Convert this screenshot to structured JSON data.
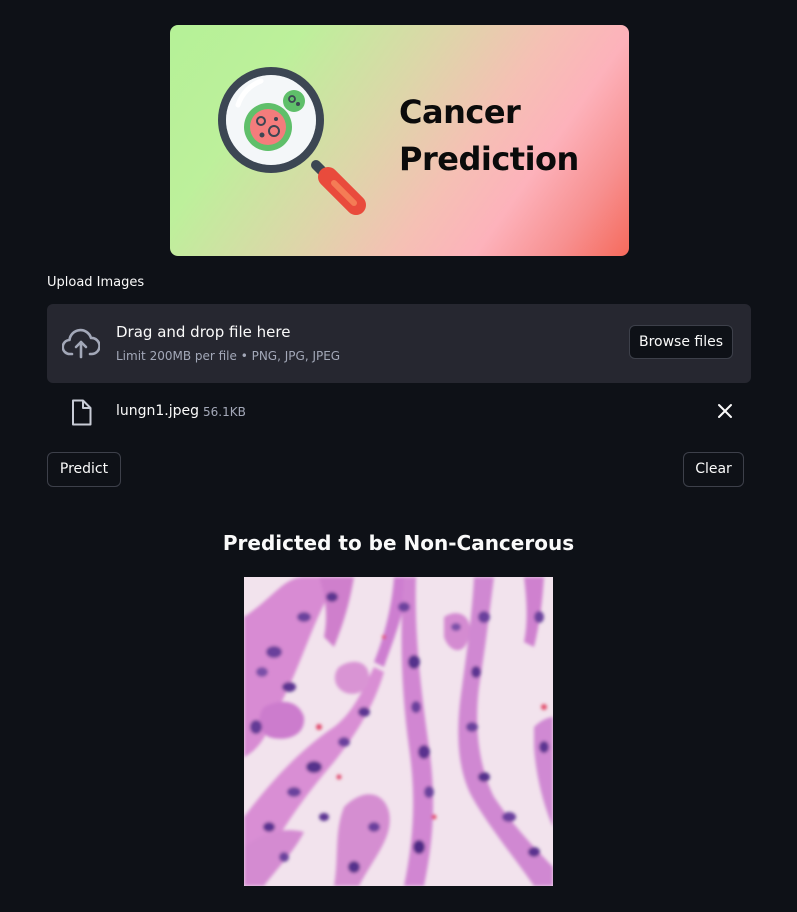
{
  "banner": {
    "title_line1": "Cancer",
    "title_line2": "Prediction",
    "icon": "magnifier-cell-icon"
  },
  "uploader": {
    "label": "Upload Images",
    "drop_title": "Drag and drop file here",
    "drop_limit": "Limit 200MB per file • PNG, JPG, JPEG",
    "browse_label": "Browse files",
    "icon": "cloud-upload-icon"
  },
  "file": {
    "name": "lungn1.jpeg",
    "size": "56.1KB",
    "icon": "file-icon",
    "remove_icon": "close-icon"
  },
  "actions": {
    "predict_label": "Predict",
    "clear_label": "Clear"
  },
  "result": {
    "title": "Predicted to be Non-Cancerous"
  },
  "colors": {
    "background": "#0e1117",
    "dropzone": "#262730",
    "text": "#fafafa",
    "muted": "#a3a8b8",
    "border": "#3d404a"
  }
}
